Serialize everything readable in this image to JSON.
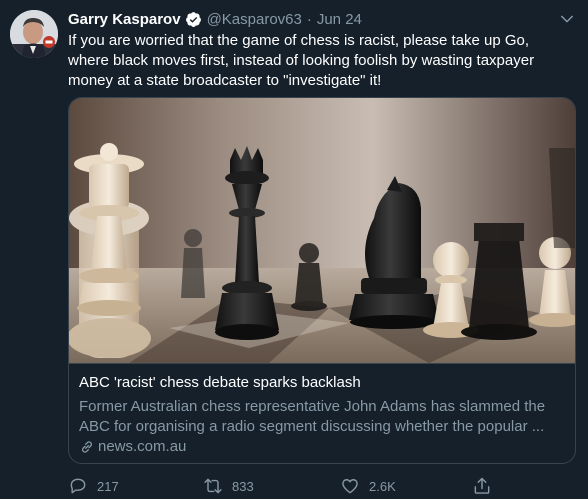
{
  "author": {
    "name": "Garry Kasparov",
    "handle": "@Kasparov63",
    "separator": "·",
    "date": "Jun 24"
  },
  "tweet_text": "If you are worried that the game of chess is racist, please take up Go, where black moves first, instead of looking foolish by wasting taxpayer money at a state broadcaster to \"investigate\" it!",
  "card": {
    "title": "ABC 'racist' chess debate sparks backlash",
    "description_line1": "Former Australian chess representative John Adams has slammed the",
    "description_line2": "ABC for organising a radio segment discussing whether the popular ...",
    "domain": "news.com.au"
  },
  "actions": {
    "replies": "217",
    "retweets": "833",
    "likes": "2.6K"
  },
  "icons": [
    "verified-badge-icon",
    "chevron-down-icon",
    "link-icon",
    "reply-icon",
    "retweet-icon",
    "like-icon",
    "share-icon"
  ],
  "colors": {
    "background": "#15202b",
    "text_primary": "#ffffff",
    "text_secondary": "#8899a6",
    "accent": "#1da1f2",
    "border": "#38444d"
  }
}
